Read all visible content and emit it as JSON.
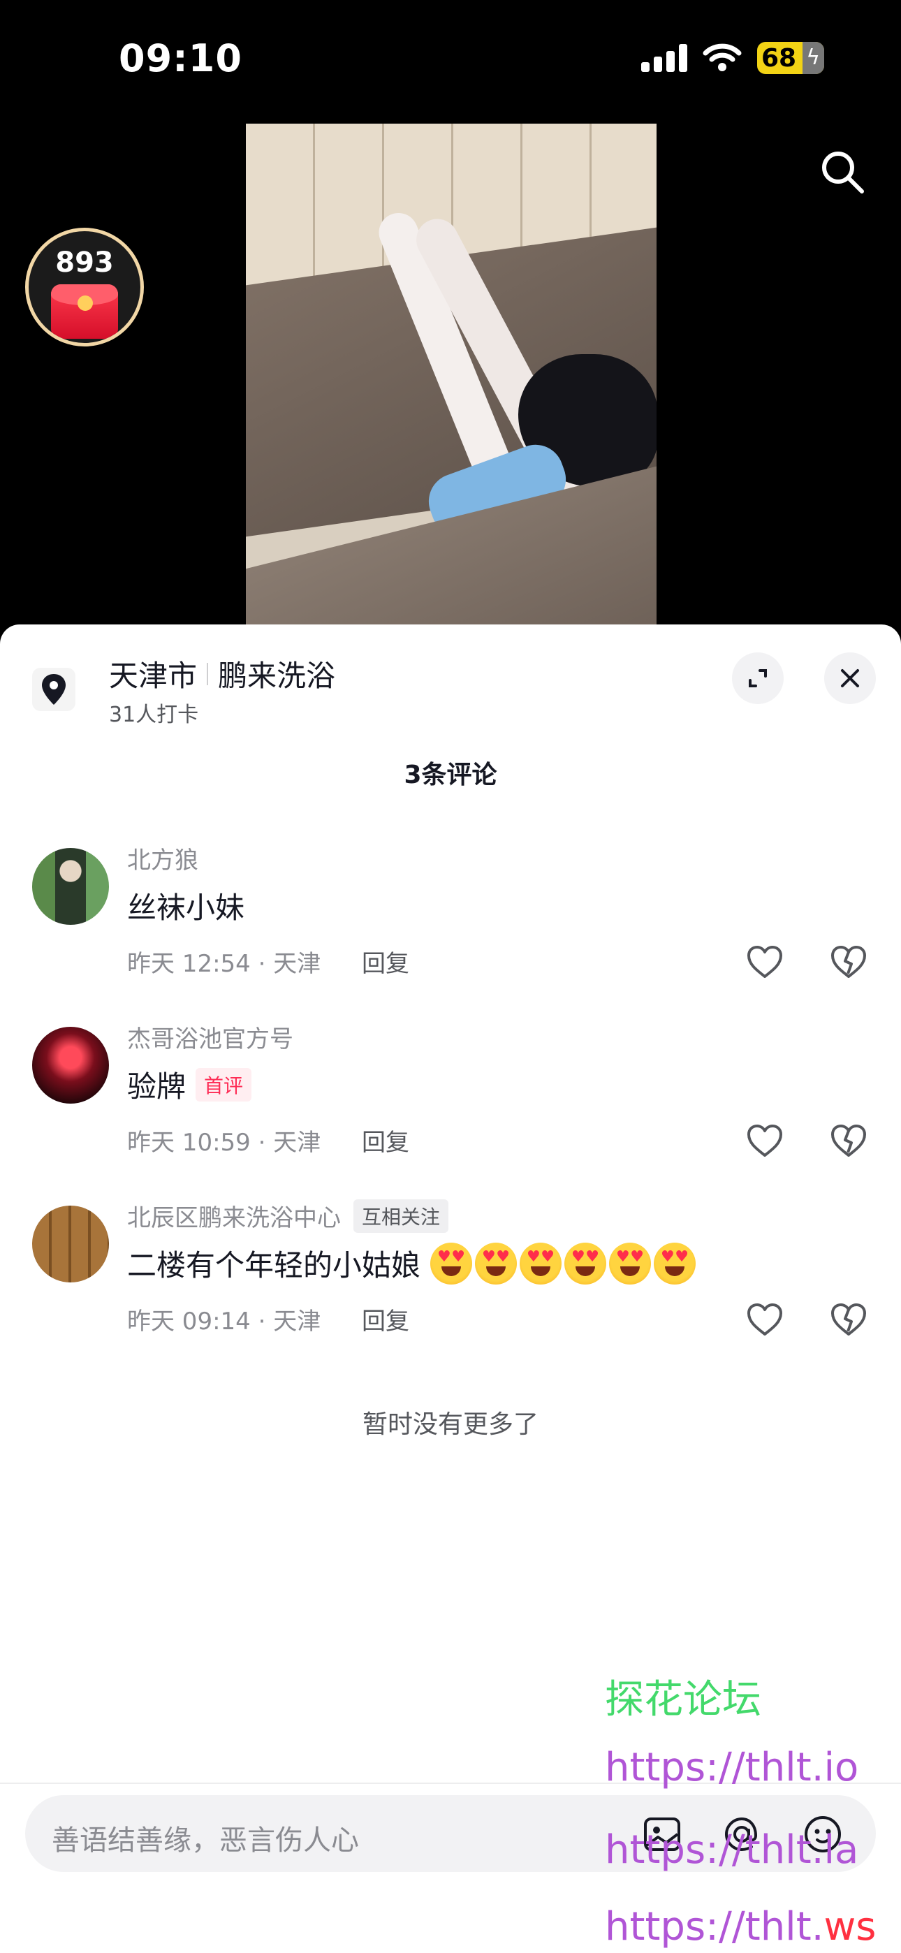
{
  "status": {
    "time": "09:10",
    "battery": "68"
  },
  "redpacket": {
    "count": "893"
  },
  "location": {
    "city": "天津市",
    "place": "鹏来洗浴",
    "checkins": "31人打卡"
  },
  "comments_header": "3条评论",
  "comments": [
    {
      "user": "北方狼",
      "tag": "",
      "text": "丝袜小妹",
      "badge": "",
      "meta": "昨天 12:54 · 天津",
      "reply": "回复",
      "emoji_count": 0
    },
    {
      "user": "杰哥浴池官方号",
      "tag": "",
      "text": "验牌",
      "badge": "首评",
      "meta": "昨天 10:59 · 天津",
      "reply": "回复",
      "emoji_count": 0
    },
    {
      "user": "北辰区鹏来洗浴中心",
      "tag": "互相关注",
      "text": "二楼有个年轻的小姑娘",
      "badge": "",
      "meta": "昨天 09:14 · 天津",
      "reply": "回复",
      "emoji_count": 6,
      "emoji_name": "heart-eyes-emoji"
    }
  ],
  "no_more": "暂时没有更多了",
  "watermark": {
    "line1": "探花论坛",
    "line2": "https://thlt.io",
    "line3": "https://thlt.la",
    "line4_prefix": "https://thlt.",
    "line4_suffix": "ws"
  },
  "input": {
    "placeholder": "善语结善缘，恶言伤人心"
  },
  "colors": {
    "accent_red": "#fe2c55",
    "watermark_green": "#43d96b",
    "watermark_purple": "#b055d6"
  }
}
